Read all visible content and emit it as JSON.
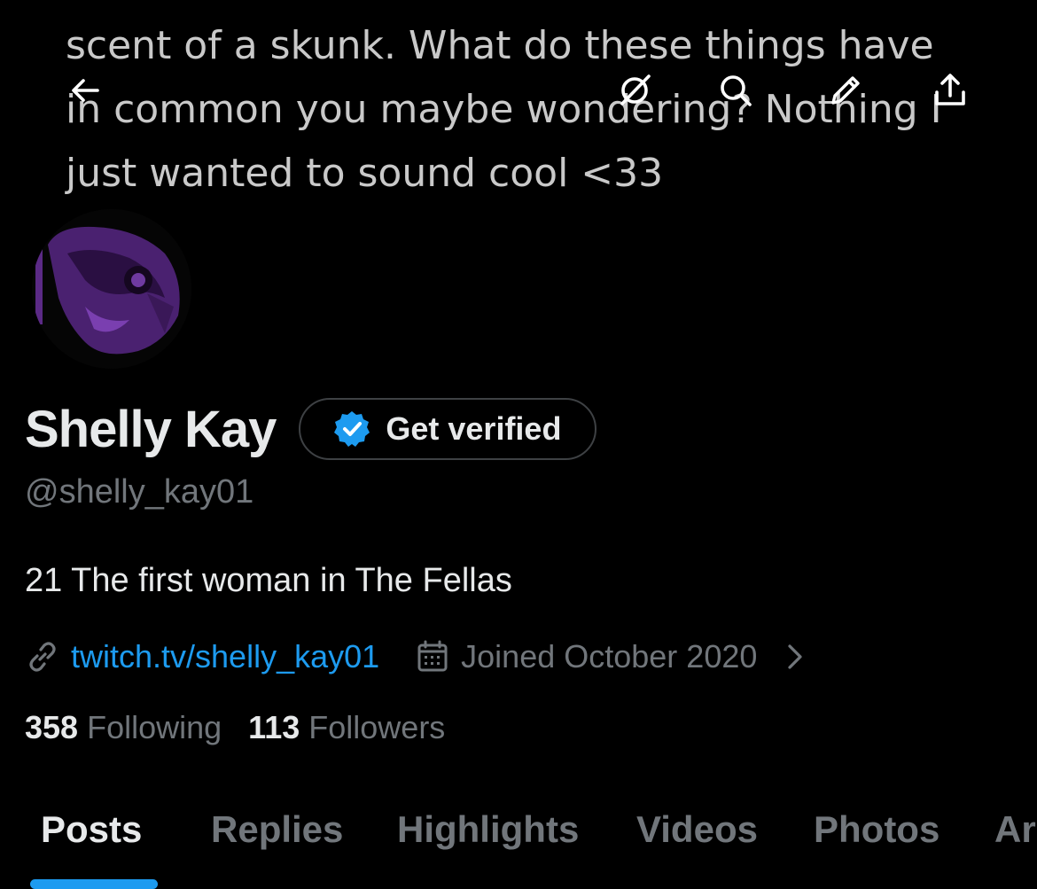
{
  "banner": {
    "line1": "scent of a skunk. What do these things have",
    "line2": "in common you maybe wondering? Nothing I",
    "line3": "just wanted to sound cool <33"
  },
  "topbar": {
    "icons": [
      "back-arrow-icon",
      "grok-icon",
      "search-icon",
      "edit-icon",
      "share-icon"
    ]
  },
  "profile": {
    "display_name": "Shelly Kay",
    "get_verified_label": "Get verified",
    "handle": "@shelly_kay01",
    "bio": "21 The first woman in The Fellas",
    "link": "twitch.tv/shelly_kay01",
    "joined": "Joined October 2020"
  },
  "stats": {
    "following_count": "358",
    "following_label": "Following",
    "followers_count": "113",
    "followers_label": "Followers"
  },
  "tabs": [
    {
      "label": "Posts",
      "active": true
    },
    {
      "label": "Replies",
      "active": false
    },
    {
      "label": "Highlights",
      "active": false
    },
    {
      "label": "Videos",
      "active": false
    },
    {
      "label": "Photos",
      "active": false
    },
    {
      "label": "Ar",
      "active": false
    }
  ],
  "colors": {
    "background": "#000000",
    "accent": "#1d9bf0",
    "text_primary": "#e7e9ea",
    "text_secondary": "#71767b",
    "avatar_purple": "#5b2a86"
  }
}
